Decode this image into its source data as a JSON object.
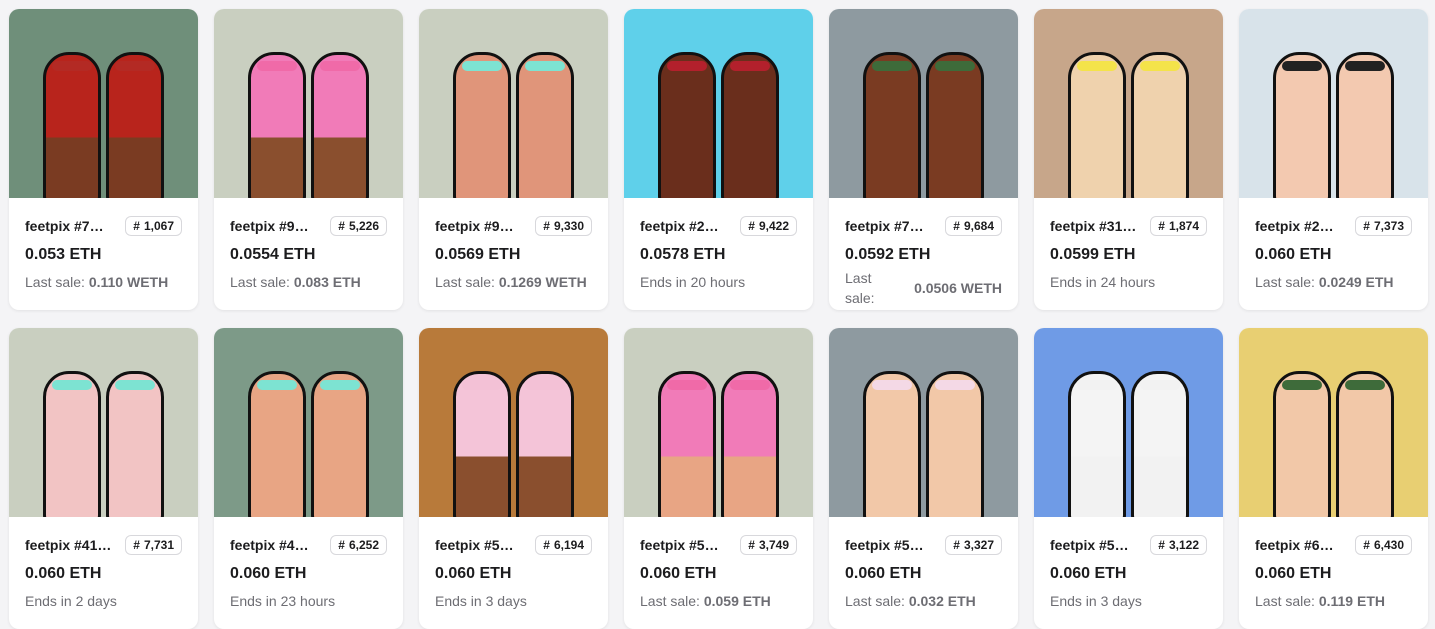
{
  "colors": {
    "page_bg": "#f4f4f6",
    "card_bg": "#ffffff",
    "text": "#1c1c1e",
    "muted": "#6d6d73"
  },
  "cards": [
    {
      "name": "feetpix #7…",
      "rank": "1,067",
      "price": "0.053 ETH",
      "meta_label": "Last sale:",
      "meta_value": "0.110 WETH",
      "art": {
        "bg": "#6f8f7a",
        "skin": "#7a3b22",
        "nail": "#b32a24",
        "shoe": "#b8241c"
      }
    },
    {
      "name": "feetpix #9…",
      "rank": "5,226",
      "price": "0.0554 ETH",
      "meta_label": "Last sale:",
      "meta_value": "0.083 ETH",
      "art": {
        "bg": "#c9cfc0",
        "skin": "#8a4f2e",
        "nail": "#f06aa8",
        "shoe": "#f17bb8"
      }
    },
    {
      "name": "feetpix #9…",
      "rank": "9,330",
      "price": "0.0569 ETH",
      "meta_label": "Last sale:",
      "meta_value": "0.1269 WETH",
      "art": {
        "bg": "#c9cfc0",
        "skin": "#e0957a",
        "nail": "#7de3d2",
        "shoe": ""
      }
    },
    {
      "name": "feetpix #2…",
      "rank": "9,422",
      "price": "0.0578 ETH",
      "meta_label": "Ends in 20 hours",
      "meta_value": "",
      "art": {
        "bg": "#5fd0ea",
        "skin": "#6a2e1c",
        "nail": "#b3202c",
        "shoe": ""
      }
    },
    {
      "name": "feetpix #7…",
      "rank": "9,684",
      "price": "0.0592 ETH",
      "meta_label": "Last sale:",
      "meta_value": "0.0506 WETH",
      "wrap": true,
      "art": {
        "bg": "#8e9aa0",
        "skin": "#7a3b22",
        "nail": "#3e6b3a",
        "shoe": ""
      }
    },
    {
      "name": "feetpix #31…",
      "rank": "1,874",
      "price": "0.0599 ETH",
      "meta_label": "Ends in 24 hours",
      "meta_value": "",
      "art": {
        "bg": "#c7a68a",
        "skin": "#efd2ad",
        "nail": "#f4e34a",
        "shoe": ""
      }
    },
    {
      "name": "feetpix #2…",
      "rank": "7,373",
      "price": "0.060 ETH",
      "meta_label": "Last sale:",
      "meta_value": "0.0249 ETH",
      "art": {
        "bg": "#d8e3ea",
        "skin": "#f3c9b0",
        "nail": "#222222",
        "shoe": ""
      }
    },
    {
      "name": "feetpix #41…",
      "rank": "7,731",
      "price": "0.060 ETH",
      "meta_label": "Ends in 2 days",
      "meta_value": "",
      "art": {
        "bg": "#c9cfc0",
        "skin": "#f2c4c4",
        "nail": "#7de3d2",
        "shoe": ""
      }
    },
    {
      "name": "feetpix #4…",
      "rank": "6,252",
      "price": "0.060 ETH",
      "meta_label": "Ends in 23 hours",
      "meta_value": "",
      "art": {
        "bg": "#7d9a88",
        "skin": "#e8a584",
        "nail": "#7de3d2",
        "shoe": ""
      }
    },
    {
      "name": "feetpix #5…",
      "rank": "6,194",
      "price": "0.060 ETH",
      "meta_label": "Ends in 3 days",
      "meta_value": "",
      "art": {
        "bg": "#b87a3a",
        "skin": "#8a4f2e",
        "nail": "#f3c1d6",
        "shoe": "#f4c4d8"
      }
    },
    {
      "name": "feetpix #5…",
      "rank": "3,749",
      "price": "0.060 ETH",
      "meta_label": "Last sale:",
      "meta_value": "0.059 ETH",
      "art": {
        "bg": "#c9cfc0",
        "skin": "#e8a584",
        "nail": "#f06aa8",
        "shoe": "#f17bb8"
      }
    },
    {
      "name": "feetpix #5…",
      "rank": "3,327",
      "price": "0.060 ETH",
      "meta_label": "Last sale:",
      "meta_value": "0.032 ETH",
      "art": {
        "bg": "#8e9aa0",
        "skin": "#f2c8a8",
        "nail": "#f4d9e6",
        "shoe": ""
      }
    },
    {
      "name": "feetpix #5…",
      "rank": "3,122",
      "price": "0.060 ETH",
      "meta_label": "Ends in 3 days",
      "meta_value": "",
      "art": {
        "bg": "#6f9be6",
        "skin": "#f2f2f2",
        "nail": "#f2f2f2",
        "shoe": "#f4f4f4"
      }
    },
    {
      "name": "feetpix #6…",
      "rank": "6,430",
      "price": "0.060 ETH",
      "meta_label": "Last sale:",
      "meta_value": "0.119 ETH",
      "art": {
        "bg": "#e8cf72",
        "skin": "#f2c8a8",
        "nail": "#3e6b3a",
        "shoe": ""
      }
    }
  ]
}
